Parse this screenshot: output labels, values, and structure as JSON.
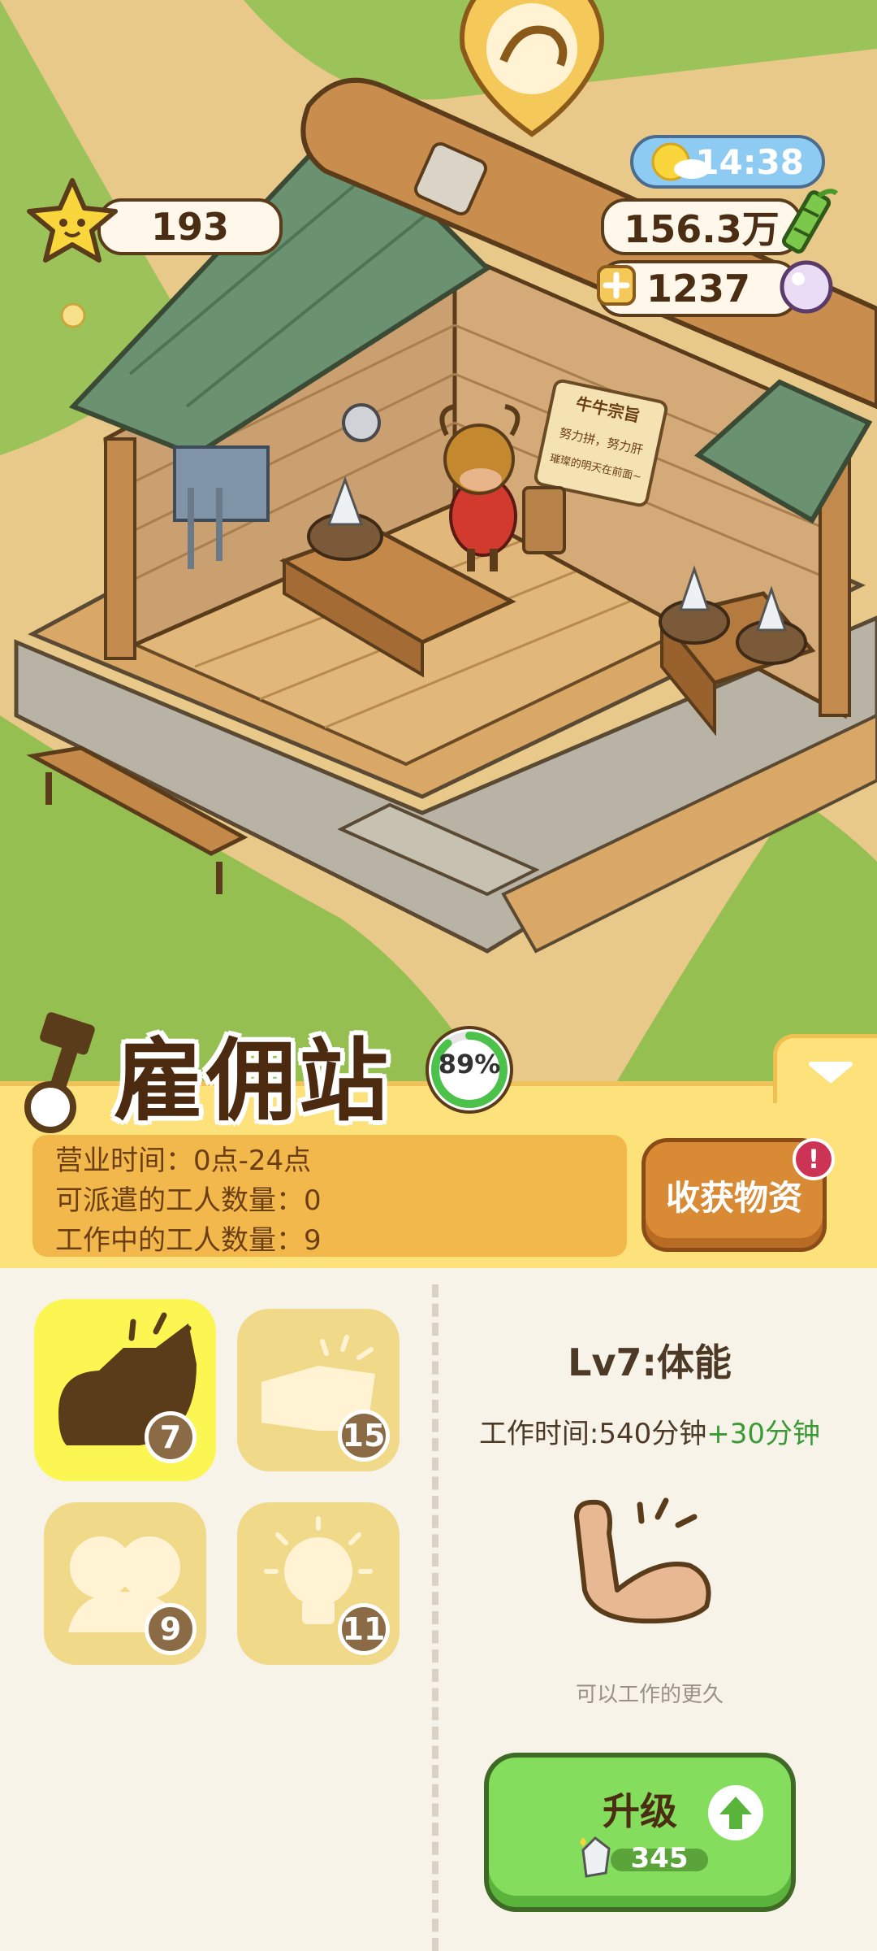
{
  "hud": {
    "stars": "193",
    "time": "14:38",
    "bamboo": "156.3万",
    "pearls": "1237"
  },
  "station": {
    "title": "雇佣站",
    "progress_text": "89%",
    "progress_value": 0.89,
    "info": [
      "营业时间：0点-24点",
      "可派遣的工人数量：0",
      "工作中的工人数量：9"
    ],
    "harvest_label": "收获物资",
    "alert": "!"
  },
  "sign": {
    "title": "牛牛宗旨",
    "line1": "努力拼，努力肝",
    "line2": "璀璨的明天在前面~"
  },
  "skills": [
    {
      "name": "strength",
      "level": "7"
    },
    {
      "name": "book",
      "level": "15"
    },
    {
      "name": "team",
      "level": "9"
    },
    {
      "name": "idea",
      "level": "11"
    }
  ],
  "detail": {
    "title": "Lv7:体能",
    "work_time_prefix": "工作时间:540分钟",
    "work_time_bonus": "+30分钟",
    "description": "可以工作的更久",
    "upgrade_label": "升级",
    "upgrade_cost": "345"
  },
  "colors": {
    "panel": "#fde17a",
    "active_skill": "#fbf651",
    "upgrade_green": "#84dd5c",
    "bonus_green": "#3a9a35"
  }
}
